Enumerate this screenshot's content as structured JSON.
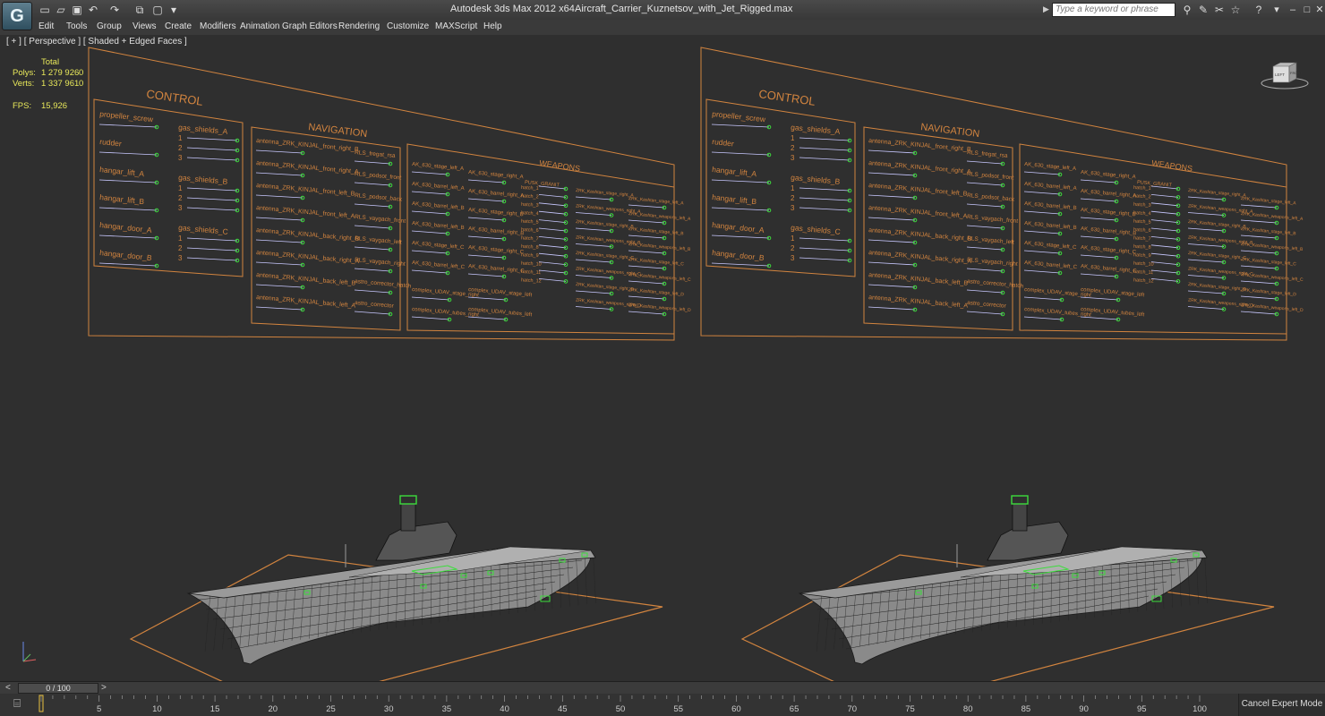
{
  "window": {
    "app_title": "Autodesk 3ds Max  2012 x64",
    "file_title": "Aircraft_Carrier_Kuznetsov_with_Jet_Rigged.max",
    "search_placeholder": "Type a keyword or phrase",
    "app_icon_glyph": "G"
  },
  "quick_access": [
    "new-icon",
    "open-icon",
    "save-icon",
    "undo-icon",
    "redo-icon",
    "hold-icon",
    "fetch-icon",
    "project-icon"
  ],
  "menu": [
    "Edit",
    "Tools",
    "Group",
    "Views",
    "Create",
    "Modifiers",
    "Animation",
    "Graph Editors",
    "Rendering",
    "Customize",
    "MAXScript",
    "Help"
  ],
  "viewport": {
    "label": "[ + ] [ Perspective ] [ Shaded + Edged Faces ]",
    "stats": {
      "header": "Total",
      "polys_label": "Polys:",
      "polys_value": "1 279 926",
      "polys_sel": "0",
      "verts_label": "Verts:",
      "verts_value": "1 337 961",
      "verts_sel": "0",
      "fps_label": "FPS:",
      "fps_value": "15,926"
    },
    "viewcube": {
      "left": "LEFT",
      "front": "FRONT"
    }
  },
  "rig_panel": {
    "control_title": "CONTROL",
    "navigation_title": "NAVIGATION",
    "weapons_title": "WEAPONS",
    "control_left": [
      "propeller_screw",
      "rudder",
      "hangar_lift_A",
      "hangar_lift_B",
      "hangar_door_A",
      "hangar_door_B"
    ],
    "gas_groups": [
      "gas_shields_A",
      "gas_shields_B",
      "gas_shields_C"
    ],
    "gas_numbers": [
      "1",
      "2",
      "3"
    ],
    "nav_left": [
      "antenna_ZRK_KINJAL_front_right_B",
      "antenna_ZRK_KINJAL_front_right_A",
      "antenna_ZRK_KINJAL_front_left_B",
      "antenna_ZRK_KINJAL_front_left_A",
      "antenna_ZRK_KINJAL_back_right_B",
      "antenna_ZRK_KINJAL_back_right_A",
      "antenna_ZRK_KINJAL_back_left_B",
      "antenna_ZRK_KINJAL_back_left_A"
    ],
    "nav_right": [
      "RLS_fregat_rsa",
      "RLS_podsot_front",
      "RLS_podsot_back",
      "RLS_vaygach_front",
      "RLS_vaygach_left",
      "RLS_vaygach_right",
      "astro_corrector_hatch",
      "astro_corrector"
    ],
    "weap_col1": [
      "AK_630_stage_left_A",
      "AK_630_barrel_left_A",
      "AK_630_barrel_left_B",
      "AK_630_barrel_left_B",
      "AK_630_stage_left_C",
      "AK_630_barrel_left_C"
    ],
    "weap_col2": [
      "AK_630_stage_right_A",
      "AK_630_barrel_right_A",
      "AK_630_stage_right_B",
      "AK_630_barrel_right_B",
      "AK_630_stage_right_C",
      "AK_630_barrel_right_C"
    ],
    "weap_bottom": [
      "complex_UDAV_stage_right",
      "complex_UDAV_stage_left",
      "complex_UDAV_tubes_right",
      "complex_UDAV_tubes_left"
    ],
    "weap_hatch_header": "PUSK_GRANIT",
    "weap_hatches": [
      "hatch_1",
      "hatch_2",
      "hatch_3",
      "hatch_4",
      "hatch_5",
      "hatch_6",
      "hatch_7",
      "hatch_8",
      "hatch_9",
      "hatch_10",
      "hatch_11",
      "hatch_12"
    ],
    "weap_col4": [
      "ZRK_Kashtan_stage_right_A",
      "ZRK_Kashtan_weapons_right_A",
      "ZRK_Kashtan_stage_right_B",
      "ZRK_Kashtan_weapons_right_B",
      "ZRK_Kashtan_stage_right_C",
      "ZRK_Kashtan_weapons_right_C",
      "ZRK_Kashtan_stage_right_D",
      "ZRK_Kashtan_weapons_right_D"
    ],
    "weap_col5": [
      "ZRK_Kashtan_stage_left_A",
      "ZRK_Kashtan_weapons_left_A",
      "ZRK_Kashtan_stage_left_B",
      "ZRK_Kashtan_weapons_left_B",
      "ZRK_Kashtan_stage_left_C",
      "ZRK_Kashtan_weapons_left_C",
      "ZRK_Kashtan_stage_left_D",
      "ZRK_Kashtan_weapons_left_D"
    ]
  },
  "timeline": {
    "frame_display": "0 / 100",
    "prev": "<",
    "next": ">",
    "ticks": [
      "0",
      "5",
      "10",
      "15",
      "20",
      "25",
      "30",
      "35",
      "40",
      "45",
      "50",
      "55",
      "60",
      "65",
      "70",
      "75",
      "80",
      "85",
      "90",
      "95",
      "100"
    ]
  },
  "expert_mode_button": "Cancel Expert Mode",
  "colors": {
    "panel_orange": "#d2843f",
    "control_green": "#3cdc3c",
    "stats_yellow": "#e8e85a",
    "viewport_bg": "#2f2f2f"
  }
}
